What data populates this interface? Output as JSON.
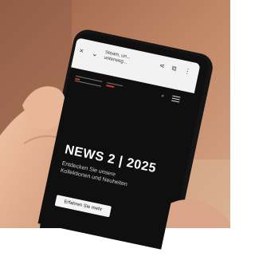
{
  "browser": {
    "close_icon": "×",
    "back_icon": "⌄",
    "title": "Steam, un...",
    "subtitle": "unterweg...",
    "share_icon": "⋖",
    "save_icon": "⧉",
    "more_icon": "⋮"
  },
  "site": {
    "search_icon": "⌕",
    "headline": "NEWS 2 | 2025",
    "subline": "Entdecken Sie unsere Kollektionen und Neuheiten",
    "cta_label": "Erfahren Sie mehr"
  },
  "colors": {
    "background": "#b4785a",
    "phone_body": "#151515",
    "screen_dark": "#0f0f10",
    "accent": "#c93a2a",
    "skin": "#e4b08f"
  }
}
